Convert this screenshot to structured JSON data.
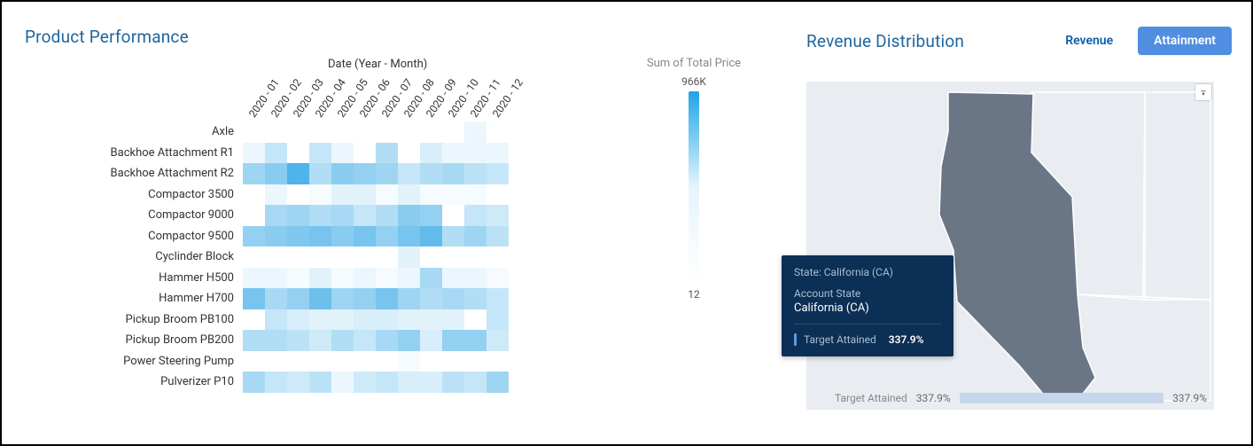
{
  "left": {
    "title": "Product Performance",
    "x_axis_title": "Date (Year - Month)"
  },
  "right": {
    "title": "Revenue Distribution",
    "toggle_revenue": "Revenue",
    "toggle_attainment": "Attainment",
    "tooltip": {
      "state_line": "State: California (CA)",
      "account_state_label": "Account State",
      "account_state_value": "California (CA)",
      "metric_label": "Target Attained",
      "metric_value": "337.9%"
    },
    "scale": {
      "label": "Target Attained",
      "min": "337.9%",
      "max": "337.9%"
    }
  },
  "legend": {
    "title": "Sum of Total Price",
    "max": "966Κ",
    "min": "12"
  },
  "chart_data": [
    {
      "type": "heatmap",
      "title": "Product Performance",
      "xlabel": "Date (Year - Month)",
      "ylabel": "",
      "value_label": "Sum of Total Price",
      "scale": {
        "min": 12,
        "max": 966000
      },
      "x": [
        "2020 - 01",
        "2020 - 02",
        "2020 - 03",
        "2020 - 04",
        "2020 - 05",
        "2020 - 06",
        "2020 - 07",
        "2020 - 08",
        "2020 - 09",
        "2020 - 10",
        "2020 - 11",
        "2020 - 12"
      ],
      "y": [
        "Axle",
        "Backhoe Attachment R1",
        "Backhoe Attachment R2",
        "Compactor 3500",
        "Compactor 9000",
        "Compactor 9500",
        "Cyclinder Block",
        "Hammer H500",
        "Hammer H700",
        "Pickup Broom PB100",
        "Pickup Broom PB200",
        "Power Steering Pump",
        "Pulverizer P10"
      ],
      "z": [
        [
          0.0,
          0.0,
          0.0,
          0.0,
          0.0,
          0.0,
          0.0,
          0.0,
          0.0,
          0.0,
          0.1,
          0.0
        ],
        [
          0.1,
          0.3,
          0.0,
          0.3,
          0.1,
          0.0,
          0.4,
          0.0,
          0.2,
          0.1,
          0.1,
          0.1
        ],
        [
          0.5,
          0.6,
          0.9,
          0.4,
          0.6,
          0.55,
          0.5,
          0.3,
          0.4,
          0.45,
          0.35,
          0.3
        ],
        [
          0.0,
          0.1,
          0.0,
          0.05,
          0.15,
          0.15,
          0.05,
          0.15,
          0.05,
          0.05,
          0.05,
          0.0
        ],
        [
          0.0,
          0.45,
          0.5,
          0.4,
          0.45,
          0.3,
          0.4,
          0.6,
          0.55,
          0.0,
          0.3,
          0.25
        ],
        [
          0.55,
          0.6,
          0.65,
          0.7,
          0.6,
          0.7,
          0.55,
          0.7,
          0.8,
          0.4,
          0.5,
          0.35
        ],
        [
          0.0,
          0.0,
          0.0,
          0.0,
          0.0,
          0.0,
          0.0,
          0.15,
          0.0,
          0.0,
          0.0,
          0.0
        ],
        [
          0.1,
          0.1,
          0.05,
          0.15,
          0.05,
          0.1,
          0.05,
          0.1,
          0.45,
          0.1,
          0.1,
          0.05
        ],
        [
          0.7,
          0.45,
          0.55,
          0.75,
          0.5,
          0.55,
          0.7,
          0.5,
          0.4,
          0.45,
          0.4,
          0.3
        ],
        [
          0.0,
          0.3,
          0.2,
          0.15,
          0.15,
          0.2,
          0.2,
          0.15,
          0.15,
          0.15,
          0.0,
          0.3
        ],
        [
          0.4,
          0.4,
          0.35,
          0.25,
          0.4,
          0.3,
          0.45,
          0.55,
          0.2,
          0.55,
          0.55,
          0.25
        ],
        [
          0.0,
          0.0,
          0.0,
          0.0,
          0.0,
          0.0,
          0.0,
          0.05,
          0.0,
          0.0,
          0.0,
          0.0
        ],
        [
          0.45,
          0.3,
          0.25,
          0.35,
          0.1,
          0.25,
          0.3,
          0.2,
          0.2,
          0.35,
          0.3,
          0.5
        ]
      ],
      "z_note": "z values are normalized 0–1 estimates read from cell shade; 0 ≈ blank/near-min, 1 ≈ 966K"
    },
    {
      "type": "map",
      "title": "Revenue Distribution",
      "metric": "Target Attained",
      "data": [
        {
          "state": "California (CA)",
          "target_attained_pct": 337.9,
          "highlighted": true
        }
      ],
      "scale": {
        "min_pct": 337.9,
        "max_pct": 337.9
      }
    }
  ]
}
